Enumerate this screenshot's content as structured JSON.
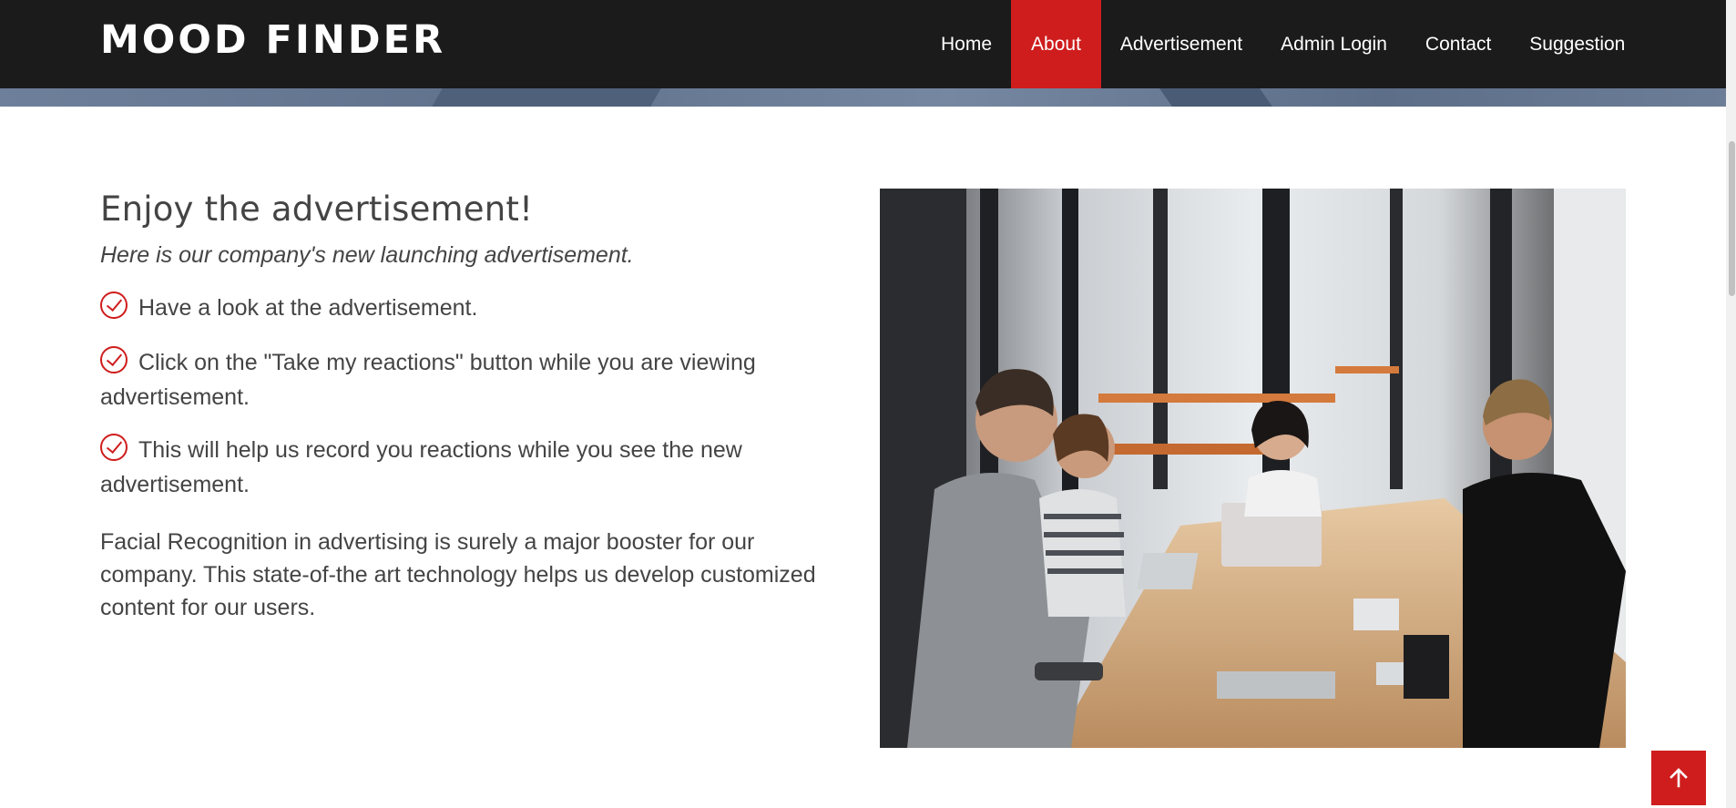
{
  "brand": "MOOD FINDER",
  "nav": {
    "items": [
      {
        "label": "Home"
      },
      {
        "label": "About"
      },
      {
        "label": "Advertisement"
      },
      {
        "label": "Admin Login"
      },
      {
        "label": "Contact"
      },
      {
        "label": "Suggestion"
      }
    ],
    "active": "About"
  },
  "section": {
    "title": "Enjoy the advertisement!",
    "subtitle": "Here is our company's new launching advertisement.",
    "checklist": [
      "Have a look at the advertisement.",
      "Click on the \"Take my reactions\" button while you are viewing advertisement.",
      "This will help us record you reactions while you see the new advertisement."
    ],
    "paragraph": "Facial Recognition in advertising is surely a major booster for our company. This state-of-the art technology helps us develop customized content for our users."
  },
  "icons": {
    "check": "check-circle-icon",
    "back_to_top": "arrow-up-icon"
  },
  "colors": {
    "header_bg": "#1b1b1b",
    "accent": "#cf1d1d",
    "text": "#444444",
    "nav_text": "#ffffff"
  }
}
